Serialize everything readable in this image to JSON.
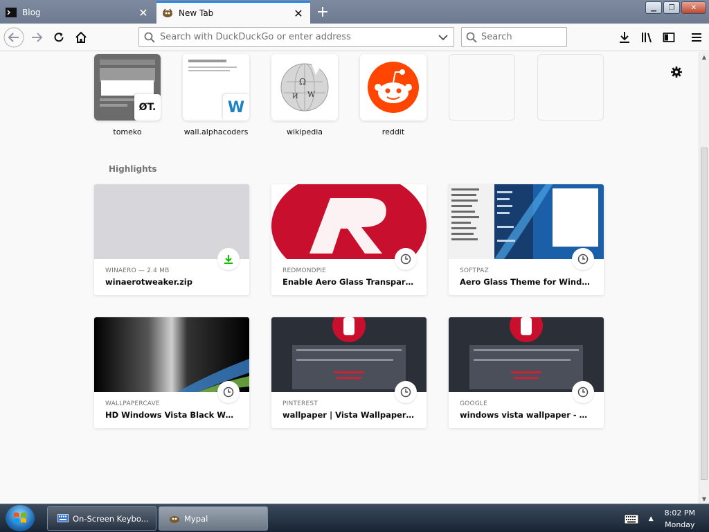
{
  "tabs": [
    {
      "title": "Blog",
      "active": false
    },
    {
      "title": "New Tab",
      "active": true
    }
  ],
  "toolbar": {
    "url_placeholder": "Search with DuckDuckGo or enter address",
    "search_placeholder": "Search"
  },
  "topsites": [
    {
      "label": "tomeko",
      "badge": "ØT."
    },
    {
      "label": "wall.alphacoders",
      "badge": "W"
    },
    {
      "label": "wikipedia"
    },
    {
      "label": "reddit"
    },
    {
      "label": ""
    },
    {
      "label": ""
    }
  ],
  "highlights": {
    "title": "Highlights",
    "cards": [
      {
        "source": "WINAERO — 2.4 MB",
        "title": "winaerotweaker.zip",
        "badge": "download-icon"
      },
      {
        "source": "REDMONDPIE",
        "title": "Enable Aero Glass Transparency ...",
        "badge": "clock-icon"
      },
      {
        "source": "SOFTPAZ",
        "title": "Aero Glass Theme for Windows XP",
        "badge": "clock-icon"
      },
      {
        "source": "WALLPAPERCAVE",
        "title": "HD Windows Vista Black Wallpa...",
        "badge": "clock-icon"
      },
      {
        "source": "PINTEREST",
        "title": "wallpaper | Vista Wallpapers – W...",
        "badge": "clock-icon"
      },
      {
        "source": "GOOGLE",
        "title": "windows vista wallpaper - Googl...",
        "badge": "clock-icon"
      }
    ]
  },
  "taskbar": {
    "items": [
      "On-Screen Keybo...",
      "Mypal"
    ],
    "time": "8:02 PM",
    "day": "Monday"
  },
  "colors": {
    "accent": "#0a84ff",
    "reddit": "#ff4500",
    "download_green": "#12bc00"
  }
}
